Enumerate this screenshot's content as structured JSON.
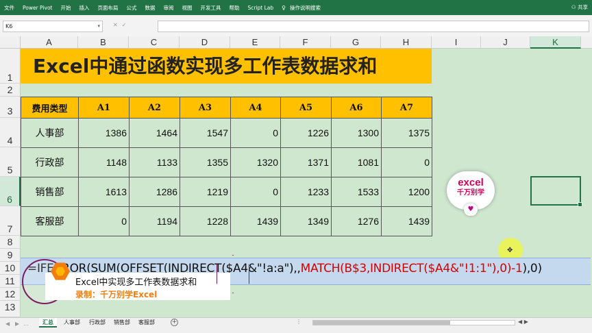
{
  "ribbon": {
    "tabs": [
      "文件",
      "Power Pivot",
      "开始",
      "插入",
      "页面布局",
      "公式",
      "数据",
      "审阅",
      "视图",
      "开发工具",
      "帮助",
      "Script Lab"
    ],
    "search": "操作说明搜索",
    "share": "共享",
    "bg_color": "#217346"
  },
  "formula_bar": {
    "name_box": "K6",
    "formula": ""
  },
  "columns": [
    "A",
    "B",
    "C",
    "D",
    "E",
    "F",
    "G",
    "H",
    "I",
    "J",
    "K"
  ],
  "selected_column": "K",
  "rows": [
    "1",
    "2",
    "3",
    "4",
    "5",
    "6",
    "7",
    "8",
    "9",
    "10",
    "11",
    "12",
    "13"
  ],
  "selected_row": "6",
  "sheet": {
    "title": "Excel中通过函数实现多工作表数据求和",
    "headers": [
      "费用类型",
      "A1",
      "A2",
      "A3",
      "A4",
      "A5",
      "A6",
      "A7"
    ],
    "data": [
      {
        "dept": "人事部",
        "values": [
          "1386",
          "1464",
          "1547",
          "0",
          "1226",
          "1300",
          "1375"
        ]
      },
      {
        "dept": "行政部",
        "values": [
          "1148",
          "1133",
          "1355",
          "1320",
          "1371",
          "1081",
          "0"
        ]
      },
      {
        "dept": "销售部",
        "values": [
          "1613",
          "1286",
          "1219",
          "0",
          "1233",
          "1533",
          "1200"
        ]
      },
      {
        "dept": "客服部",
        "values": [
          "0",
          "1194",
          "1228",
          "1439",
          "1349",
          "1276",
          "1439"
        ]
      }
    ],
    "header_color": "#ffc000",
    "sheet_bg": "#cfe6cf"
  },
  "formula_display": {
    "part1": "=IFERROR(SUM(OFFSET(INDIRECT($A4&\"!a:a\"),,",
    "part2": "MATCH(B$3,INDIRECT($A4&\"!1:1\"),0)-1",
    "part3": "),0)"
  },
  "logo": {
    "line1": "excel",
    "line2": "千万别学",
    "heart": "heart-icon"
  },
  "caption": {
    "title": "Excel中实现多工作表数据求和",
    "subtitle": "录制：千万别学Excel"
  },
  "sheet_tabs": {
    "tabs": [
      "汇总",
      "人事部",
      "行政部",
      "销售部",
      "客服部"
    ],
    "active": "汇总"
  }
}
